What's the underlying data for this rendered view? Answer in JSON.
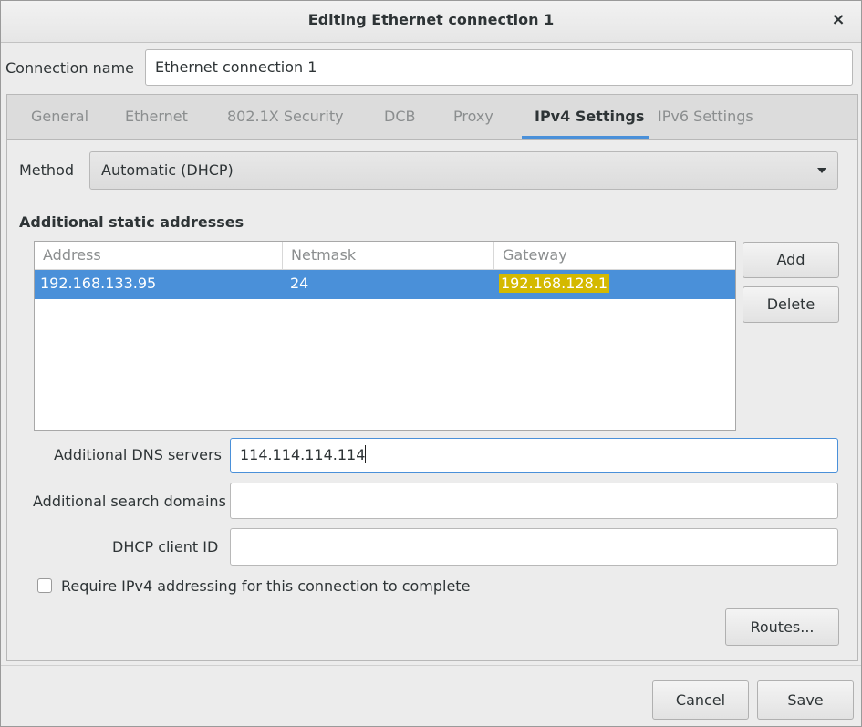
{
  "window": {
    "title": "Editing Ethernet connection 1",
    "close_icon": "×"
  },
  "connection_name": {
    "label": "Connection name",
    "value": "Ethernet connection 1"
  },
  "tabs": [
    {
      "label": "General"
    },
    {
      "label": "Ethernet"
    },
    {
      "label": "802.1X Security"
    },
    {
      "label": "DCB"
    },
    {
      "label": "Proxy"
    },
    {
      "label": "IPv4 Settings",
      "active": true
    },
    {
      "label": "IPv6 Settings"
    }
  ],
  "method": {
    "label": "Method",
    "value": "Automatic (DHCP)"
  },
  "addresses": {
    "title": "Additional static addresses",
    "columns": [
      "Address",
      "Netmask",
      "Gateway"
    ],
    "rows": [
      {
        "address": "192.168.133.95",
        "netmask": "24",
        "gateway": "192.168.128.1",
        "selected": true
      }
    ],
    "add_label": "Add",
    "delete_label": "Delete"
  },
  "dns": {
    "label": "Additional DNS servers",
    "value": "114.114.114.114"
  },
  "search_domains": {
    "label": "Additional search domains",
    "value": ""
  },
  "dhcp_client_id": {
    "label": "DHCP client ID",
    "value": ""
  },
  "require_ipv4": {
    "label": "Require IPv4 addressing for this connection to complete",
    "checked": false
  },
  "routes_label": "Routes...",
  "footer": {
    "cancel_label": "Cancel",
    "save_label": "Save"
  },
  "colors": {
    "accent": "#4a90d9",
    "highlight": "#d4b900"
  }
}
